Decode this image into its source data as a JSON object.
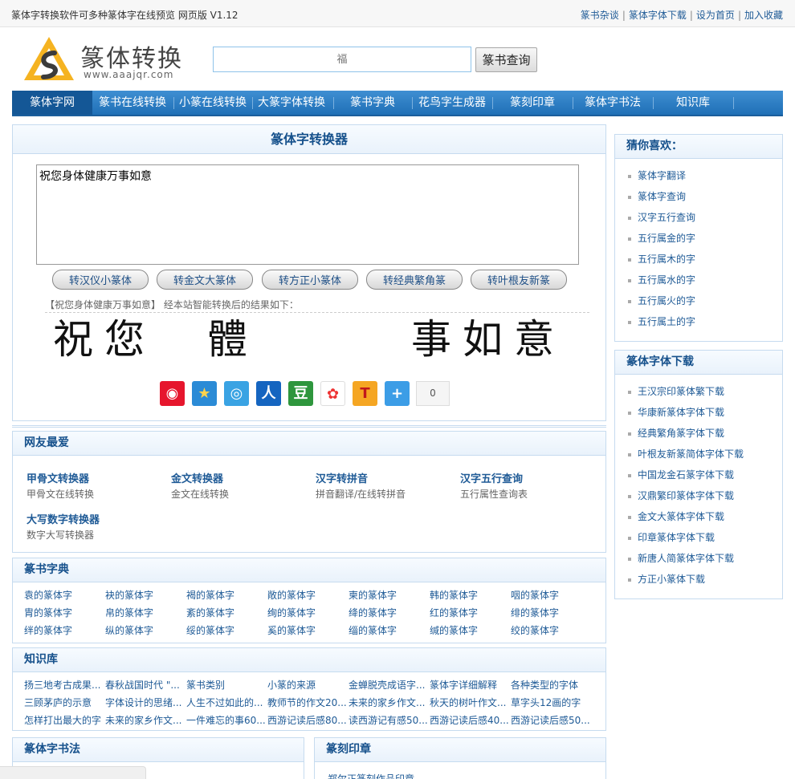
{
  "topbar": {
    "tagline": "篆体字转换软件可多种篆体字在线预览 网页版 V1.12",
    "links": [
      "篆书杂谈",
      "篆体字体下载",
      "设为首页",
      "加入收藏"
    ]
  },
  "header": {
    "logo_title": "篆体转换",
    "logo_url": "www.aaajqr.com",
    "search_placeholder": "福",
    "search_button": "篆书查询"
  },
  "nav": [
    "篆体字网",
    "篆书在线转换",
    "小篆在线转换",
    "大篆字体转换",
    "篆书字典",
    "花鸟字生成器",
    "篆刻印章",
    "篆体字书法",
    "知识库"
  ],
  "converter": {
    "title": "篆体字转换器",
    "input_text": "祝您身体健康万事如意",
    "buttons": [
      "转汉仪小篆体",
      "转金文大篆体",
      "转方正小篆体",
      "转经典繁角篆",
      "转叶根友新篆"
    ],
    "result_label": "【祝您身体健康万事如意】 经本站智能转换后的结果如下：",
    "glyphs": [
      "祝",
      "您",
      "體",
      "事",
      "如",
      "意"
    ],
    "share_count": "0"
  },
  "favorites": {
    "title": "网友最爱",
    "items": [
      {
        "title": "甲骨文转换器",
        "desc": "甲骨文在线转换"
      },
      {
        "title": "金文转换器",
        "desc": "金文在线转换"
      },
      {
        "title": "汉字转拼音",
        "desc": "拼音翻译/在线转拼音"
      },
      {
        "title": "汉字五行查询",
        "desc": "五行属性查询表"
      },
      {
        "title": "大写数字转换器",
        "desc": "数字大写转换器"
      }
    ]
  },
  "dictionary": {
    "title": "篆书字典",
    "rows": [
      [
        "袁的篆体字",
        "袂的篆体字",
        "褐的篆体字",
        "敞的篆体字",
        "柬的篆体字",
        "韩的篆体字",
        "咽的篆体字"
      ],
      [
        "胄的篆体字",
        "帛的篆体字",
        "紊的篆体字",
        "绚的篆体字",
        "绛的篆体字",
        "红的篆体字",
        "绯的篆体字"
      ],
      [
        "绊的篆体字",
        "纵的篆体字",
        "绥的篆体字",
        "奚的篆体字",
        "缁的篆体字",
        "缄的篆体字",
        "绞的篆体字"
      ]
    ]
  },
  "knowledge": {
    "title": "知识库",
    "rows": [
      [
        "扬三地考古成果...",
        "春秋战国时代 \"...",
        "篆书类别",
        "小篆的来源",
        "金蝉脱壳成语字...",
        "篆体字详细解释",
        "各种类型的字体"
      ],
      [
        "三顾茅庐的示意",
        "字体设计的思绪...",
        "人生不过如此的...",
        "教师节的作文20...",
        "未来的家乡作文...",
        "秋天的树叶作文...",
        "草字头12画的字"
      ],
      [
        "怎样打出最大的字",
        "未来的家乡作文...",
        "一件难忘的事60...",
        "西游记读后感80...",
        "读西游记有感50...",
        "西游记读后感40...",
        "西游记读后感50..."
      ]
    ]
  },
  "calligraphy": {
    "title": "篆体字书法"
  },
  "seals": {
    "title": "篆刻印章",
    "first_item": "郑尔正篆刻作品印章"
  },
  "sidebar": {
    "guess": {
      "title": "猜你喜欢：",
      "items": [
        "篆体字翻译",
        "篆体字查询",
        "汉字五行查询",
        "五行属金的字",
        "五行属木的字",
        "五行属水的字",
        "五行属火的字",
        "五行属土的字"
      ]
    },
    "downloads": {
      "title": "篆体字体下载",
      "items": [
        "王汉宗印篆体繁下载",
        "华康新篆体字体下载",
        "经典繁角篆字体下载",
        "叶根友新篆简体字体下载",
        "中国龙金石篆字体下载",
        "汉鼎繁印篆体字体下载",
        "金文大篆体字体下载",
        "印章篆体字体下载",
        "新唐人简篆体字体下载",
        "方正小篆体下载"
      ]
    }
  },
  "colors": {
    "nav": "#1f6fb6",
    "link": "#1e5a96",
    "panel_border": "#c6dbef"
  }
}
